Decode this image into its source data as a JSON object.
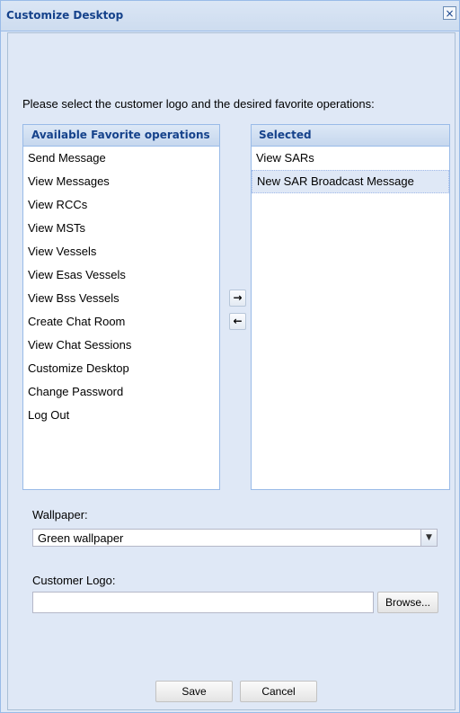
{
  "window": {
    "title": "Customize Desktop",
    "close_glyph": "×"
  },
  "intro_text": "Please select the customer logo and the desired favorite operations:",
  "available": {
    "header": "Available Favorite operations",
    "items": [
      "Send Message",
      "View Messages",
      "View RCCs",
      "View MSTs",
      "View Vessels",
      "View Esas Vessels",
      "View Bss Vessels",
      "Create Chat Room",
      "View Chat Sessions",
      "Customize Desktop",
      "Change Password",
      "Log Out"
    ]
  },
  "selected": {
    "header": "Selected",
    "items": [
      "View SARs",
      "New SAR Broadcast Message"
    ],
    "highlighted_index": 1
  },
  "move_buttons": {
    "add_glyph": "→",
    "remove_glyph": "←"
  },
  "wallpaper": {
    "label": "Wallpaper:",
    "value": "Green wallpaper",
    "trigger_glyph": "▼"
  },
  "logo": {
    "label": "Customer Logo:",
    "value": "",
    "browse_label": "Browse..."
  },
  "actions": {
    "save_label": "Save",
    "cancel_label": "Cancel"
  }
}
